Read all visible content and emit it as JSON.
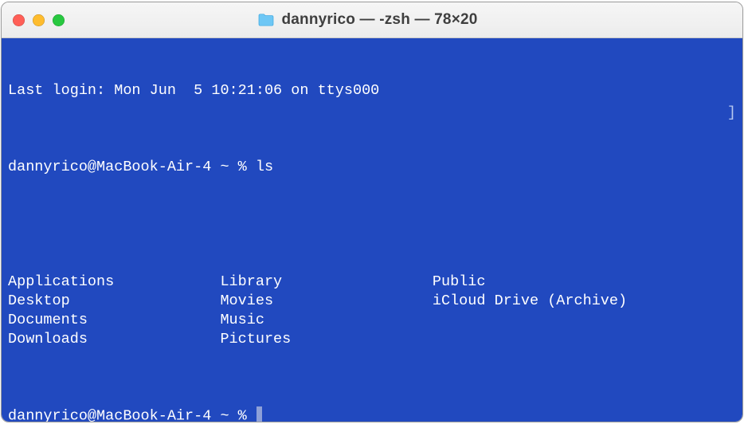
{
  "window": {
    "title": "dannyrico — -zsh — 78×20"
  },
  "terminal": {
    "last_login": "Last login: Mon Jun  5 10:21:06 on ttys000",
    "prompt1_user": "dannyrico@MacBook-Air-4",
    "prompt1_path": "~",
    "prompt1_symbol": "%",
    "prompt1_command": "ls",
    "ls_rows": [
      [
        "Applications",
        "Library",
        "Public"
      ],
      [
        "Desktop",
        "Movies",
        "iCloud Drive (Archive)"
      ],
      [
        "Documents",
        "Music",
        ""
      ],
      [
        "Downloads",
        "Pictures",
        ""
      ]
    ],
    "prompt2_user": "dannyrico@MacBook-Air-4",
    "prompt2_path": "~",
    "prompt2_symbol": "%"
  }
}
